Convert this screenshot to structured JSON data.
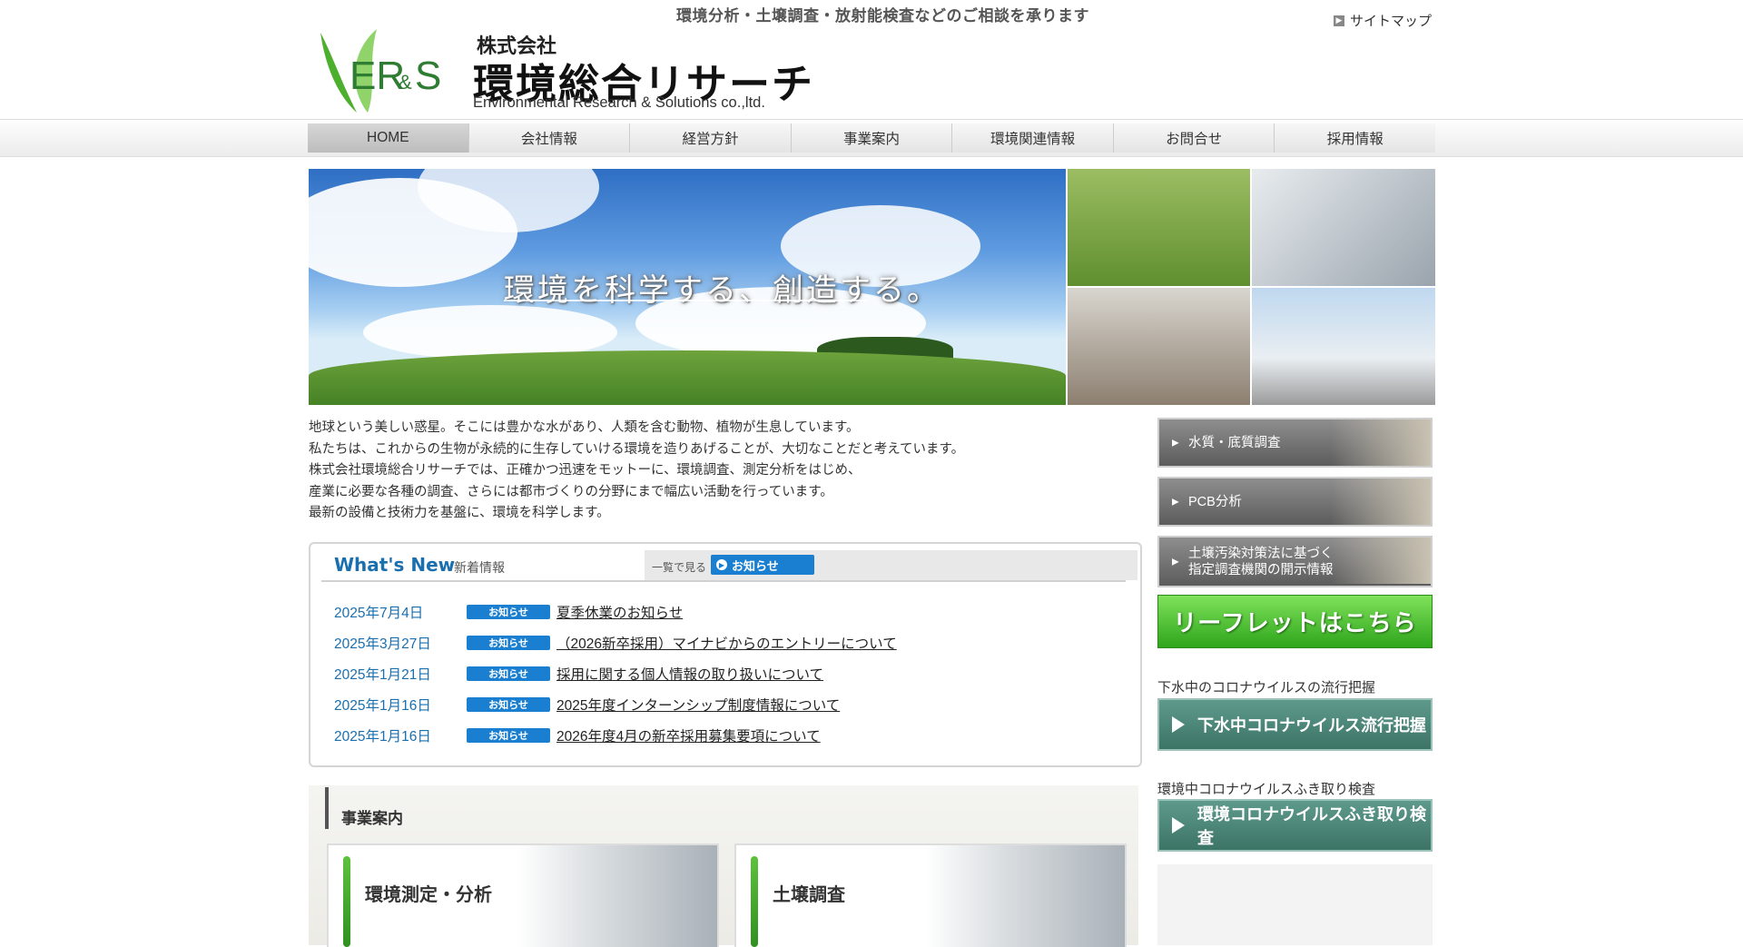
{
  "header": {
    "tagline": "環境分析・土壌調査・放射能検査などのご相談を承ります",
    "logo_mark": "ER&S",
    "company_prefix": "株式会社",
    "company_name": "環境総合リサーチ",
    "company_en": "Environmental Research & Solutions co.,ltd.",
    "sitemap_label": "サイトマップ"
  },
  "nav": {
    "items": [
      "HOME",
      "会社情報",
      "経営方針",
      "事業案内",
      "環境関連情報",
      "お問合せ",
      "採用情報"
    ],
    "active": "HOME"
  },
  "hero": {
    "catch": "環境を科学する、創造する。"
  },
  "intro": {
    "lines": [
      "地球という美しい惑星。そこには豊かな水があり、人類を含む動物、植物が生息しています。",
      "私たちは、これからの生物が永続的に生存していける環境を造りあげることが、大切なことだと考えています。",
      "株式会社環境総合リサーチでは、正確かつ迅速をモットーに、環境調査、測定分析をはじめ、",
      "産業に必要な各種の調査、さらには都市づくりの分野にまで幅広い活動を行っています。",
      "最新の設備と技術力を基盤に、環境を科学します。"
    ]
  },
  "news": {
    "title": "What's New",
    "subtitle": "新着情報",
    "more_label": "一覧で見る",
    "more_button": "お知らせ",
    "items": [
      {
        "date": "2025年7月4日",
        "badge": "お知らせ",
        "title": "夏季休業のお知らせ"
      },
      {
        "date": "2025年3月27日",
        "badge": "お知らせ",
        "title": "（2026新卒採用）マイナビからのエントリーについて"
      },
      {
        "date": "2025年1月21日",
        "badge": "お知らせ",
        "title": "採用に関する個人情報の取り扱いについて"
      },
      {
        "date": "2025年1月16日",
        "badge": "お知らせ",
        "title": "2025年度インターンシップ制度情報について"
      },
      {
        "date": "2025年1月16日",
        "badge": "お知らせ",
        "title": "2026年度4月の新卒採用募集要項について"
      }
    ]
  },
  "business": {
    "heading": "事業案内",
    "cards": [
      "環境測定・分析",
      "土壌調査"
    ]
  },
  "sidebar": {
    "water": "水質・底質調査",
    "pcb": "PCB分析",
    "soil_line1": "土壌汚染対策法に基づく",
    "soil_line2": "指定調査機関の開示情報",
    "leaflet": "リーフレットはこちら",
    "caption_1": "下水中のコロナウイルスの流行把握",
    "corona_1": "下水中コロナウイルス流行把握",
    "caption_2": "環境中コロナウイルスふき取り検査",
    "corona_2": "環境コロナウイルスふき取り検査"
  },
  "colors": {
    "accent_blue": "#1a7fd0",
    "leaf_green": "#4caf2e",
    "corona_teal": "#4a8577"
  }
}
